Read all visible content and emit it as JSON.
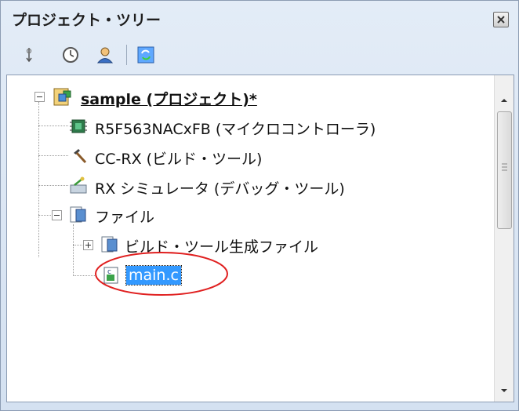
{
  "window": {
    "title": "プロジェクト・ツリー"
  },
  "toolbar": {
    "buttons": [
      {
        "name": "sort-icon"
      },
      {
        "name": "clock-icon"
      },
      {
        "name": "user-icon"
      },
      {
        "name": "refresh-icon"
      }
    ]
  },
  "tree": {
    "project": {
      "label": "sample (プロジェクト)*"
    },
    "items": [
      {
        "label": "R5F563NACxFB (マイクロコントローラ)",
        "icon": "microcontroller-icon"
      },
      {
        "label": "CC-RX (ビルド・ツール)",
        "icon": "hammer-icon"
      },
      {
        "label": "RX シミュレータ (デバッグ・ツール)",
        "icon": "debug-tool-icon"
      },
      {
        "label": "ファイル",
        "icon": "folder-icon"
      },
      {
        "label": "ビルド・ツール生成ファイル",
        "icon": "folder-icon"
      },
      {
        "label": "main.c",
        "icon": "c-file-icon",
        "selected": true
      }
    ]
  },
  "colors": {
    "selection": "#3399ff",
    "annotation": "#e02020"
  }
}
